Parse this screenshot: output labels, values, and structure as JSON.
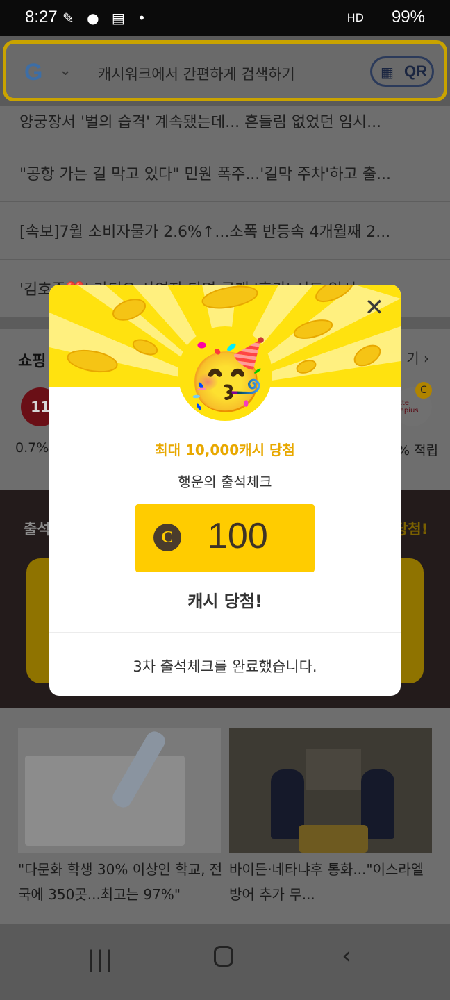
{
  "status_bar": {
    "time": "8:27",
    "left_icons": "✎ ● ▤ •",
    "signal": "HD",
    "battery": "99%"
  },
  "search": {
    "google_letter": "G",
    "placeholder": "캐시워크에서 간편하게 검색하기",
    "qr_label": "QR"
  },
  "news": [
    "양궁장서 '벌의 습격' 계속됐는데... 흔들림 없었던 임시...",
    "\"공항 가는 길 막고 있다\" 민원 폭주...'길막 주차'하고 출...",
    "[속보]7월 소비자물가 2.6%↑...소폭 반등속 4개월째 2...",
    "'김호중❤️' 라디오 사연자 다명 공개 '휴가' 시도 임시..."
  ],
  "shopping": {
    "title": "쇼핑",
    "more": "기 ›",
    "left_logo": "11",
    "left_rate": "0.7%",
    "right_badge": "C",
    "right_logo": "lotte\nmepius",
    "right_rate": "% 적립"
  },
  "attendance": {
    "left_label": "출석",
    "right_label": "당첨!"
  },
  "articles": [
    {
      "caption": "\"다문화 학생 30% 이상인 학교, 전국에 350곳...최고는 97%\""
    },
    {
      "caption": "바이든·네타냐후 통화...\"이스라엘 방어 추가 무..."
    }
  ],
  "nav": {
    "recent": "|||",
    "back": "‹"
  },
  "modal": {
    "close": "✕",
    "emoji": "🥳",
    "prize_label": "최대 10,000캐시 당첨",
    "lucky_title": "행운의 출석체크",
    "coin_symbol": "C",
    "amount": "100",
    "won_text": "캐시 당첨!",
    "complete_message": "3차 출석체크를 완료했습니다."
  },
  "colors": {
    "brand_yellow": "#ffcc00",
    "modal_top": "#ffe20f",
    "prize_text": "#e8a800"
  }
}
